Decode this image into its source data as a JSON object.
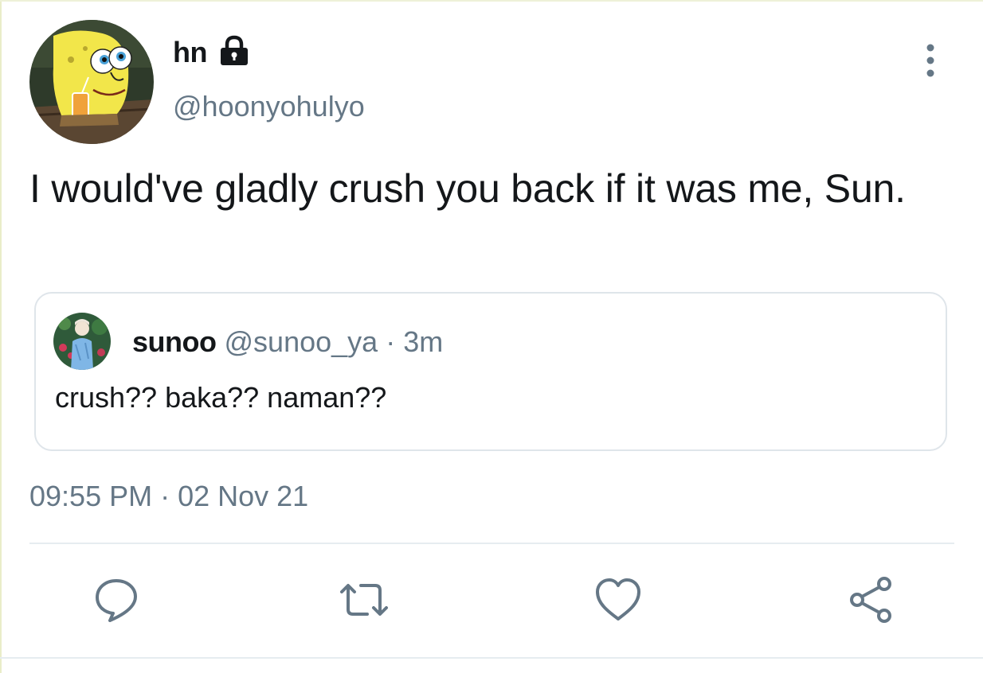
{
  "author": {
    "display_name": "hn",
    "handle": "@hoonyohulyo",
    "avatar_icon": "spongebob-avatar",
    "protected_icon": "lock-icon"
  },
  "tweet": {
    "text": "I would've gladly crush you back if it was me, Sun.",
    "timestamp": "09:55 PM · 02 Nov 21"
  },
  "quoted_tweet": {
    "display_name": "sunoo",
    "handle": "@sunoo_ya",
    "separator": "·",
    "time": "3m",
    "text": "crush?? baka?? naman??",
    "avatar_icon": "user-avatar"
  },
  "actions": [
    {
      "name": "reply",
      "icon": "reply-icon"
    },
    {
      "name": "retweet",
      "icon": "retweet-icon"
    },
    {
      "name": "like",
      "icon": "heart-icon"
    },
    {
      "name": "share",
      "icon": "share-icon"
    }
  ],
  "colors": {
    "text": "#14171a",
    "secondary": "#657786",
    "icon": "#657786",
    "border": "#dfe5ea"
  }
}
